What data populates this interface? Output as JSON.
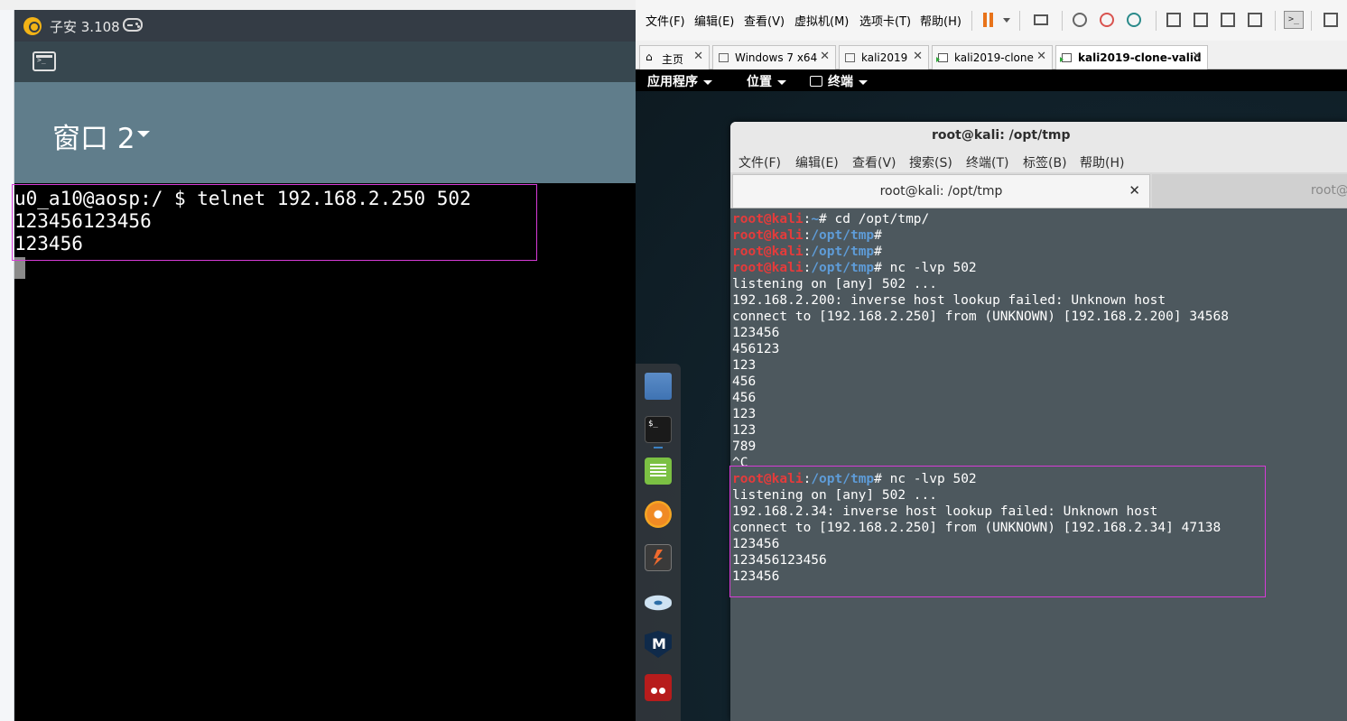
{
  "emulator": {
    "title": "子安 3.108",
    "window_name": "窗口 2",
    "terminal_lines": [
      "u0_a10@aosp:/ $ telnet 192.168.2.250 502",
      "123456123456",
      "123456"
    ]
  },
  "vmware": {
    "menu": [
      "文件(F)",
      "编辑(E)",
      "查看(V)",
      "虚拟机(M)",
      "选项卡(T)",
      "帮助(H)"
    ],
    "tabs": [
      {
        "label": "主页"
      },
      {
        "label": "Windows 7 x64"
      },
      {
        "label": "kali2019"
      },
      {
        "label": "kali2019-clone"
      },
      {
        "label": "kali2019-clone-valid"
      }
    ]
  },
  "kali": {
    "topbar": {
      "applications": "应用程序",
      "places": "位置",
      "terminal": "终端"
    },
    "terminal_window": {
      "title": "root@kali: /opt/tmp",
      "menu": [
        "文件(F)",
        "编辑(E)",
        "查看(V)",
        "搜索(S)",
        "终端(T)",
        "标签(B)",
        "帮助(H)"
      ],
      "tabs": [
        "root@kali: /opt/tmp",
        "root@k"
      ],
      "lines": [
        {
          "user": "root@kali",
          "path": "~",
          "cmd": " cd /opt/tmp/"
        },
        {
          "user": "root@kali",
          "path": "/opt/tmp",
          "cmd": ""
        },
        {
          "user": "root@kali",
          "path": "/opt/tmp",
          "cmd": ""
        },
        {
          "user": "root@kali",
          "path": "/opt/tmp",
          "cmd": " nc -lvp 502"
        },
        {
          "text": "listening on [any] 502 ..."
        },
        {
          "text": "192.168.2.200: inverse host lookup failed: Unknown host"
        },
        {
          "text": "connect to [192.168.2.250] from (UNKNOWN) [192.168.2.200] 34568"
        },
        {
          "text": "123456"
        },
        {
          "text": "456123"
        },
        {
          "text": "123"
        },
        {
          "text": "456"
        },
        {
          "text": "456"
        },
        {
          "text": "123"
        },
        {
          "text": "123"
        },
        {
          "text": "789"
        },
        {
          "text": "^C"
        },
        {
          "user": "root@kali",
          "path": "/opt/tmp",
          "cmd": " nc -lvp 502"
        },
        {
          "text": "listening on [any] 502 ..."
        },
        {
          "text": "192.168.2.34: inverse host lookup failed: Unknown host"
        },
        {
          "text": "connect to [192.168.2.250] from (UNKNOWN) [192.168.2.34] 47138"
        },
        {
          "text": "123456"
        },
        {
          "text": "123456123456"
        },
        {
          "text": "123456"
        }
      ]
    }
  },
  "colors": {
    "prompt_user": "#e53b3b",
    "prompt_path": "#5e9cd8",
    "highlight_box": "#d63bd6",
    "pause_button": "#e8731a"
  }
}
